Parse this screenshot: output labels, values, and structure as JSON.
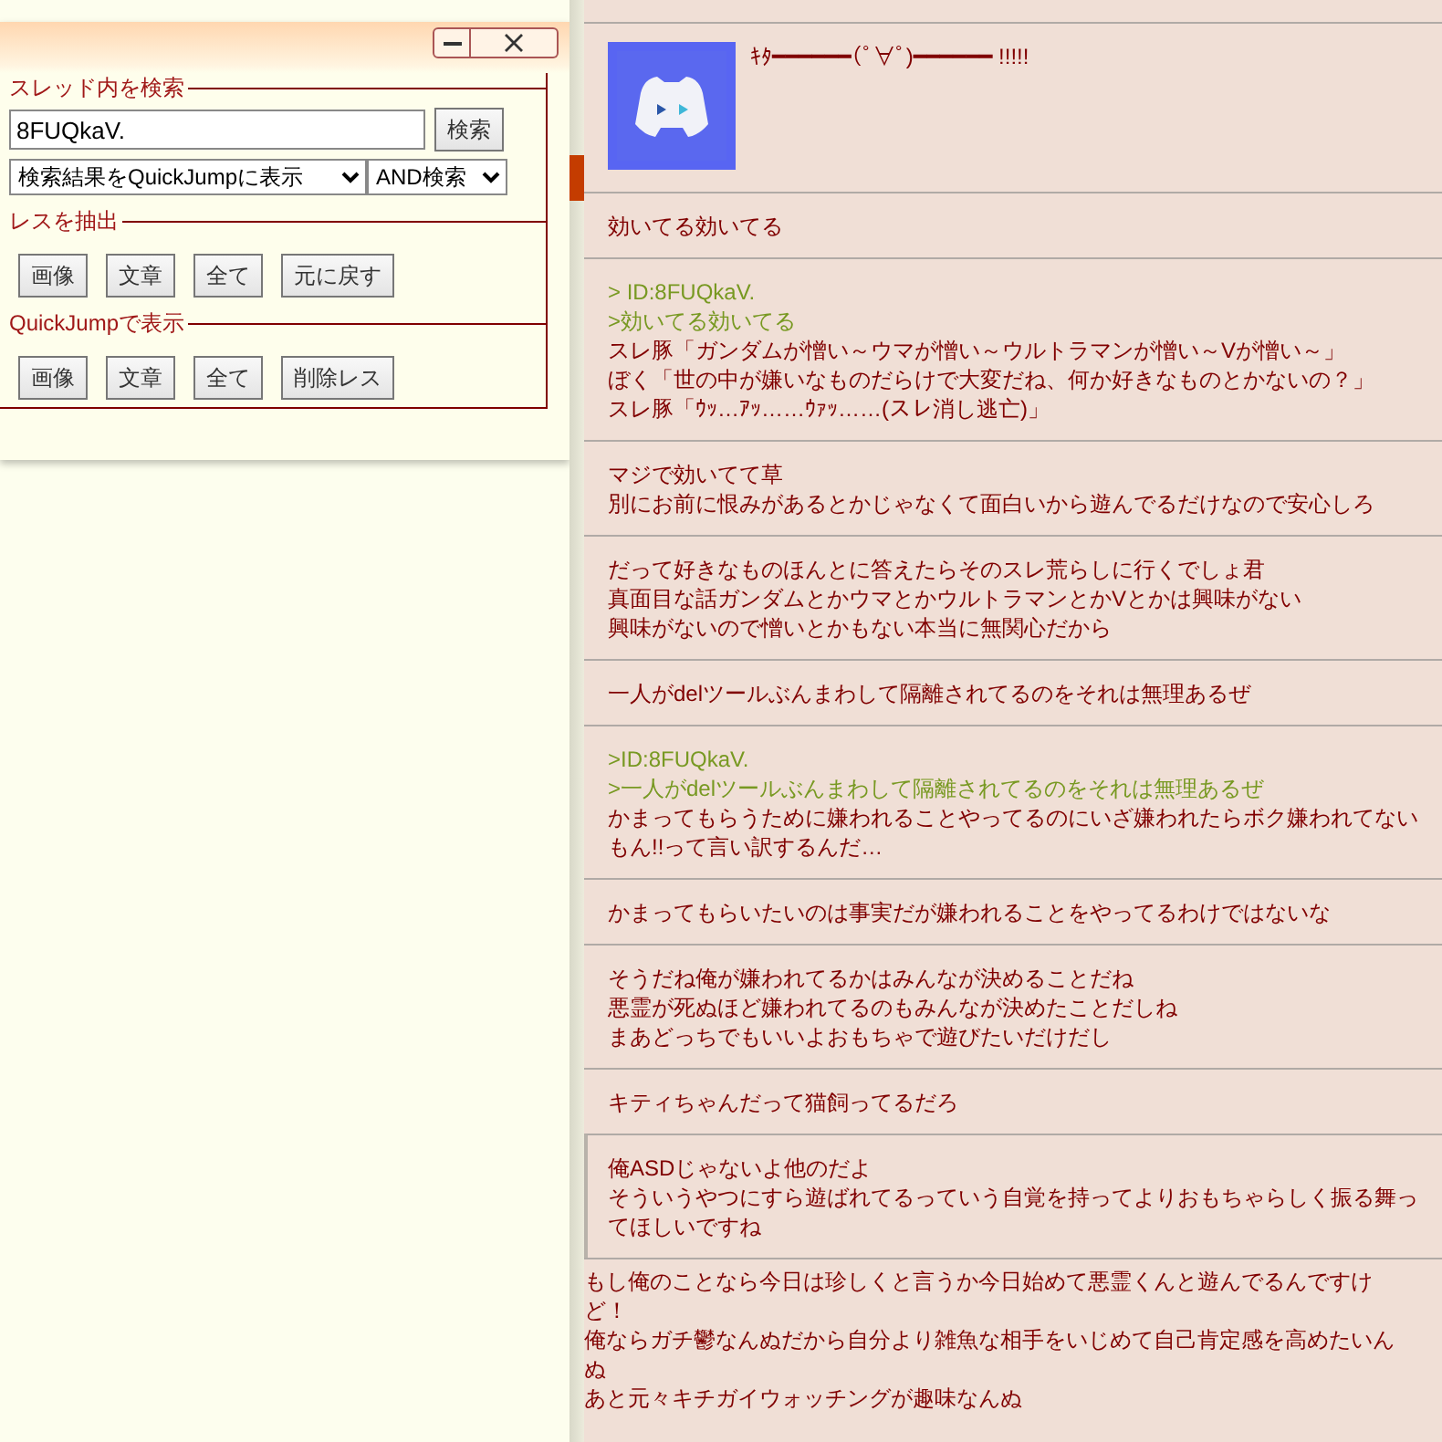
{
  "search_panel": {
    "sections": [
      {
        "legend": "スレッド内を検索",
        "kind": "search",
        "query": "8FUQkaV.",
        "search_button": "検索",
        "display_select": "検索結果をQuickJumpに表示",
        "mode_select": "AND検索"
      },
      {
        "legend": "レスを抽出",
        "kind": "buttons",
        "buttons": [
          "画像",
          "文章",
          "全て",
          "元に戻す"
        ]
      },
      {
        "legend": "QuickJumpで表示",
        "kind": "buttons",
        "buttons": [
          "画像",
          "文章",
          "全て",
          "削除レス"
        ]
      }
    ]
  },
  "posts": [
    {
      "lines": [
        {
          "text": "ｷﾀ━━━━━━(ﾟ∀ﾟ)━━━━━━ !!!!!",
          "quote": false
        }
      ]
    },
    {
      "kind": "text",
      "lines": [
        {
          "text": "効いてる効いてる",
          "quote": false
        }
      ]
    },
    {
      "kind": "text",
      "lines": [
        {
          "text": "> ID:8FUQkaV.",
          "quote": true
        },
        {
          "text": ">効いてる効いてる",
          "quote": true
        },
        {
          "text": "スレ豚「ガンダムが憎い～ウマが憎い～ウルトラマンが憎い～Vが憎い～」",
          "quote": false
        },
        {
          "text": "ぼく「世の中が嫌いなものだらけで大変だね、何か好きなものとかないの？」",
          "quote": false
        },
        {
          "text": "スレ豚「ｳｯ…ｱｯ……ｳｧｯ……(スレ消し逃亡)」",
          "quote": false
        }
      ]
    },
    {
      "kind": "text",
      "lines": [
        {
          "text": "マジで効いてて草",
          "quote": false
        },
        {
          "text": "別にお前に恨みがあるとかじゃなくて面白いから遊んでるだけなので安心しろ",
          "quote": false
        }
      ]
    },
    {
      "kind": "text",
      "lines": [
        {
          "text": "だって好きなものほんとに答えたらそのスレ荒らしに行くでしょ君",
          "quote": false
        },
        {
          "text": "真面目な話ガンダムとかウマとかウルトラマンとかVとかは興味がない",
          "quote": false
        },
        {
          "text": "興味がないので憎いとかもない本当に無関心だから",
          "quote": false
        }
      ]
    },
    {
      "kind": "text",
      "lines": [
        {
          "text": "一人がdelツールぶんまわして隔離されてるのをそれは無理あるぜ",
          "quote": false
        }
      ]
    },
    {
      "kind": "text",
      "lines": [
        {
          "text": ">ID:8FUQkaV.",
          "quote": true
        },
        {
          "text": ">一人がdelツールぶんまわして隔離されてるのをそれは無理あるぜ",
          "quote": true
        },
        {
          "text": "かまってもらうために嫌われることやってるのにいざ嫌われたらボク嫌われてないもん!!って言い訳するんだ…",
          "quote": false
        }
      ]
    },
    {
      "kind": "text",
      "lines": [
        {
          "text": "かまってもらいたいのは事実だが嫌われることをやってるわけではないな",
          "quote": false
        }
      ]
    },
    {
      "kind": "text",
      "lines": [
        {
          "text": "そうだね俺が嫌われてるかはみんなが決めることだね",
          "quote": false
        },
        {
          "text": "悪霊が死ぬほど嫌われてるのもみんなが決めたことだしね",
          "quote": false
        },
        {
          "text": "まあどっちでもいいよおもちゃで遊びたいだけだし",
          "quote": false
        }
      ]
    },
    {
      "kind": "text",
      "lines": [
        {
          "text": "キティちゃんだって猫飼ってるだろ",
          "quote": false
        }
      ]
    },
    {
      "kind": "bordered",
      "lines": [
        {
          "text": "俺ASDじゃないよ他のだよ",
          "quote": false
        },
        {
          "text": "そういうやつにすら遊ばれてるっていう自覚を持ってよりおもちゃらしく振る舞ってほしいですね",
          "quote": false
        }
      ]
    },
    {
      "kind": "bare",
      "lines": [
        {
          "text": "もし俺のことなら今日は珍しくと言うか今日始めて悪霊くんと遊んでるんですけど！",
          "quote": false
        },
        {
          "text": "俺ならガチ鬱なんぬだから自分より雑魚な相手をいじめて自己肯定感を高めたいんぬ",
          "quote": false
        },
        {
          "text": "あと元々キチガイウォッチングが趣味なんぬ",
          "quote": false
        }
      ]
    }
  ]
}
